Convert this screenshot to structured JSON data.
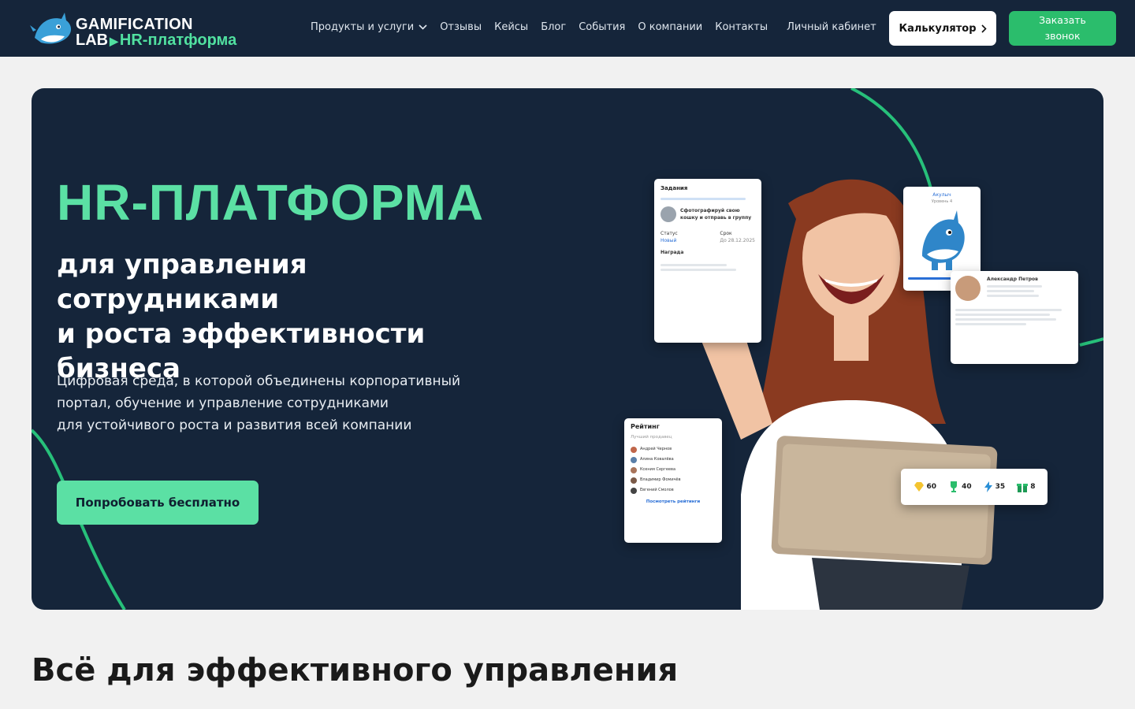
{
  "nav": {
    "logo_line1": "GAMIFICATION",
    "logo_line2_a": "LAB",
    "logo_line2_b": "HR-платформа",
    "items": [
      {
        "label": "Продукты и услуги"
      },
      {
        "label": "Отзывы"
      },
      {
        "label": "Кейсы"
      },
      {
        "label": "Блог"
      },
      {
        "label": "События"
      },
      {
        "label": "О компании"
      },
      {
        "label": "Контакты"
      },
      {
        "label": "Личный кабинет"
      }
    ],
    "calc_label": "Калькулятор",
    "call_label_1": "Заказать",
    "call_label_2": "звонок"
  },
  "hero": {
    "title": "HR-ПЛАТФОРМА",
    "subtitle_1": "для управления сотрудниками",
    "subtitle_2": "и роста эффективности",
    "subtitle_3": "бизнеса",
    "desc_1": "Цифровая среда, в которой объединены корпоративный",
    "desc_2": "портал, обучение и управление сотрудниками",
    "desc_3": "для устойчивого роста и развития всей компании",
    "cta": "Попробовать бесплатно"
  },
  "cards": {
    "tasks_title": "Задания",
    "tasks_task": "Сфотографируй свою кошку и отправь в группу",
    "tasks_status_label": "Статус",
    "tasks_status": "Новый",
    "tasks_deadline_label": "Срок",
    "tasks_deadline": "До 28.12.2025",
    "tasks_reward_label": "Награда",
    "shark_title": "Акулыч",
    "shark_level": "Уровень 4",
    "profile_name": "Александр Петров",
    "rating_title": "Рейтинг",
    "rating_sub": "Лучший продавец",
    "rating_people": [
      "Андрей Чернов",
      "Алина Ковалёва",
      "Ксения Сергеева",
      "Владимир Фомичёв",
      "Евгений Смолов"
    ],
    "rating_link": "Посмотреть рейтинги",
    "stats": [
      {
        "icon": "diamond-icon",
        "value": "60"
      },
      {
        "icon": "trophy-icon",
        "value": "40"
      },
      {
        "icon": "lightning-icon",
        "value": "35"
      },
      {
        "icon": "gift-icon",
        "value": "8"
      }
    ]
  },
  "section": {
    "title": "Всё для эффективного управления"
  },
  "colors": {
    "navy": "#15253a",
    "accent": "#5be0a4",
    "call_button": "#2bbd6c"
  }
}
